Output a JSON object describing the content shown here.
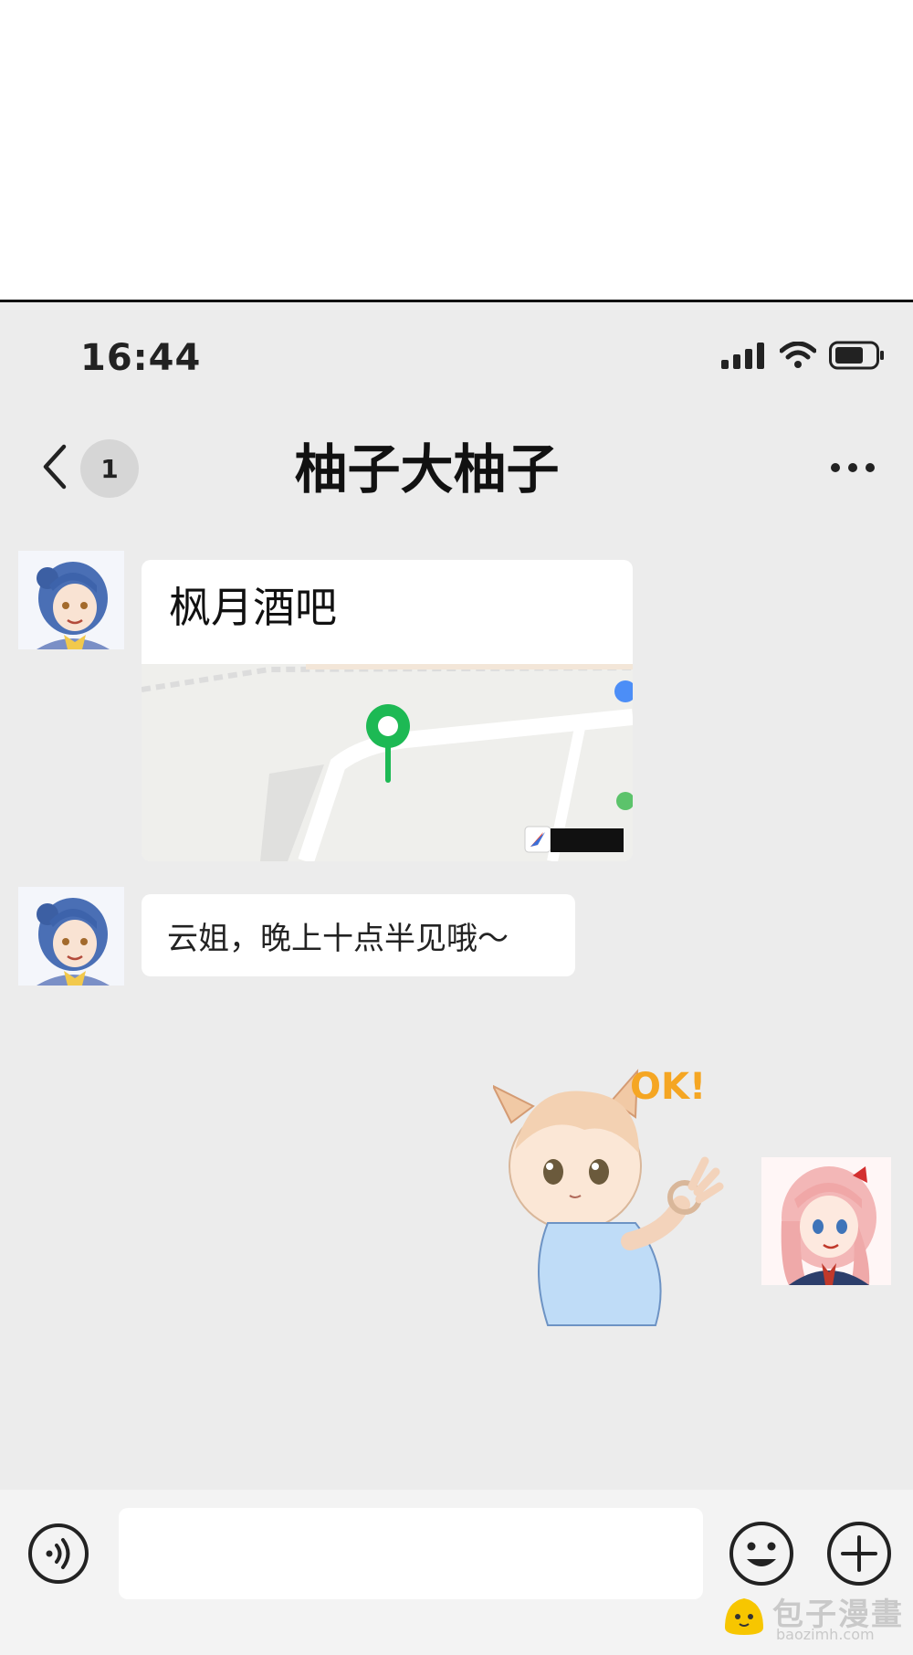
{
  "status_bar": {
    "time": "16:44"
  },
  "nav": {
    "unread_count": "1",
    "title": "柚子大柚子"
  },
  "messages": [
    {
      "type": "location",
      "sender": "contact",
      "place_name": "枫月酒吧"
    },
    {
      "type": "text",
      "sender": "contact",
      "text": "云姐，晚上十点半见哦～"
    },
    {
      "type": "sticker",
      "sender": "self",
      "caption": "OK!"
    }
  ],
  "input": {
    "placeholder": ""
  },
  "watermark": {
    "name": "包子漫畫",
    "domain": "baozimh.com"
  },
  "colors": {
    "chat_background": "#ececec",
    "bubble": "#ffffff",
    "map_pin": "#1db954",
    "sticker_text": "#f5a623"
  }
}
